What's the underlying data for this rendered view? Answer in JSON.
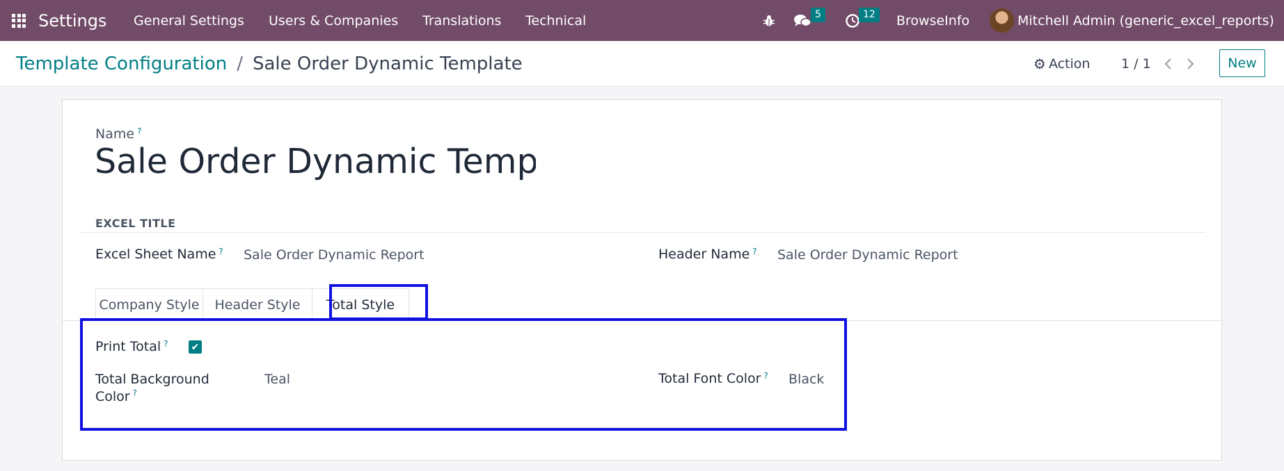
{
  "navbar": {
    "apps_icon": "apps-grid-icon",
    "brand": "Settings",
    "menu": [
      "General Settings",
      "Users & Companies",
      "Translations",
      "Technical"
    ],
    "debug_icon": "bug-icon",
    "messages_icon": "chat-icon",
    "messages_count": "5",
    "activities_icon": "clock-icon",
    "activities_count": "12",
    "company": "BrowseInfo",
    "user": "Mitchell Admin (generic_excel_reports)",
    "color": "#714b67"
  },
  "control_panel": {
    "breadcrumb": [
      "Template Configuration",
      "Sale Order Dynamic Template"
    ],
    "separator": "/",
    "action_label": "Action",
    "pager": "1 / 1",
    "new_label": "New"
  },
  "form": {
    "name_label": "Name",
    "name_value": "Sale Order Dynamic Template",
    "section_title": "EXCEL TITLE",
    "excel_sheet_name_label": "Excel Sheet Name",
    "excel_sheet_name_value": "Sale Order Dynamic Report",
    "header_name_label": "Header Name",
    "header_name_value": "Sale Order Dynamic Report",
    "tabs": [
      "Company Style",
      "Header Style",
      "Total Style"
    ],
    "active_tab": "Total Style",
    "total_style": {
      "print_total_label": "Print Total",
      "print_total_checked": true,
      "bg_color_label_line1": "Total Background",
      "bg_color_label_line2": "Color",
      "bg_color_value": "Teal",
      "font_color_label": "Total Font Color",
      "font_color_value": "Black"
    },
    "help_mark": "?"
  },
  "colors": {
    "accent": "#017e84",
    "highlight": "#1010e0"
  }
}
